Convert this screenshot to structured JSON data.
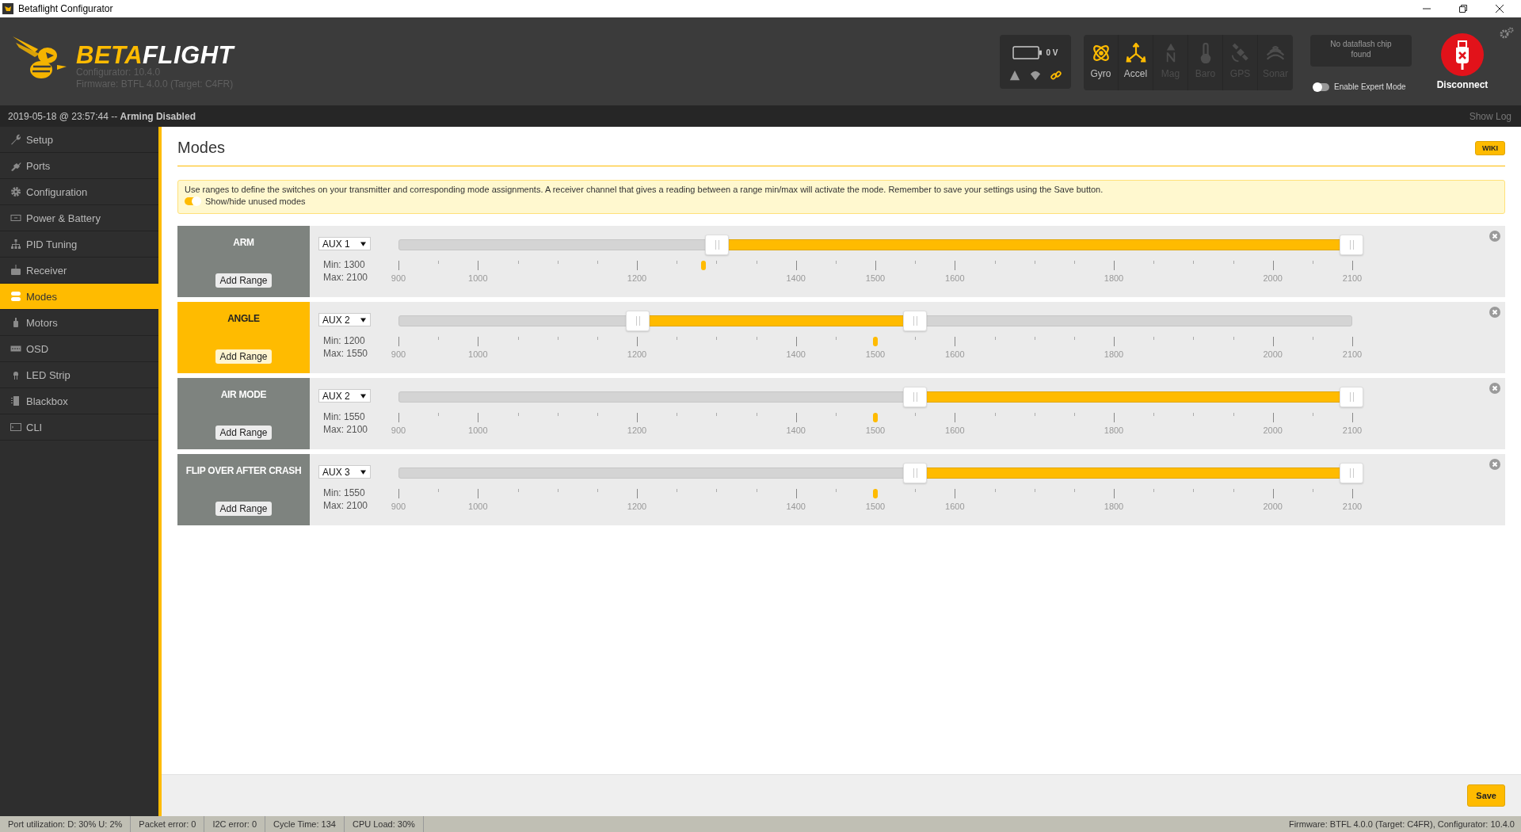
{
  "window": {
    "title": "Betaflight Configurator"
  },
  "header": {
    "logo": {
      "part_1": "BETA",
      "part_2": "FLIGHT"
    },
    "configurator_version": "Configurator: 10.4.0",
    "firmware": "Firmware: BTFL 4.0.0 (Target: C4FR)",
    "battery": {
      "voltage": "0 V"
    },
    "status_icons": [
      {
        "kind": "warning",
        "on": false
      },
      {
        "kind": "parachute",
        "on": false
      },
      {
        "kind": "link",
        "on": true
      }
    ],
    "sensors": [
      {
        "label": "Gyro",
        "kind": "gyro",
        "on": true
      },
      {
        "label": "Accel",
        "kind": "accel",
        "on": true
      },
      {
        "label": "Mag",
        "kind": "mag",
        "on": false
      },
      {
        "label": "Baro",
        "kind": "baro",
        "on": false
      },
      {
        "label": "GPS",
        "kind": "gps",
        "on": false
      },
      {
        "label": "Sonar",
        "kind": "sonar",
        "on": false
      }
    ],
    "dataflash": "No dataflash chip found",
    "expert_mode": {
      "label": "Enable Expert Mode",
      "on": false
    },
    "disconnect": "Disconnect"
  },
  "log_bar": {
    "message": "2019-05-18 @ 23:57:44 -- **Arming Disabled**",
    "show_log": "Show Log"
  },
  "sidebar": {
    "items": [
      {
        "label": "Setup",
        "kind": "wrench",
        "selected": false
      },
      {
        "label": "Ports",
        "kind": "plug",
        "selected": false
      },
      {
        "label": "Configuration",
        "kind": "gear",
        "selected": false
      },
      {
        "label": "Power & Battery",
        "kind": "battery",
        "selected": false
      },
      {
        "label": "PID Tuning",
        "kind": "tree",
        "selected": false
      },
      {
        "label": "Receiver",
        "kind": "receiver",
        "selected": false
      },
      {
        "label": "Modes",
        "kind": "toggles",
        "selected": true
      },
      {
        "label": "Motors",
        "kind": "motor",
        "selected": false
      },
      {
        "label": "OSD",
        "kind": "osd",
        "selected": false
      },
      {
        "label": "LED Strip",
        "kind": "led",
        "selected": false
      },
      {
        "label": "Blackbox",
        "kind": "blackbox",
        "selected": false
      },
      {
        "label": "CLI",
        "kind": "terminal",
        "selected": false
      }
    ]
  },
  "page": {
    "title": "Modes",
    "wiki": "WIKI",
    "note": "Use ranges to define the switches on your transmitter and corresponding mode assignments. A receiver channel that gives a reading between a range min/max will activate the mode. Remember to save your settings using the Save button.",
    "show_unused": {
      "label": "Show/hide unused modes",
      "on": true
    },
    "modes": [
      {
        "name": "ARM",
        "active": false,
        "add_range": "Add Range",
        "channel": "AUX 1",
        "min": "Min: 1300",
        "max": "Max: 2100",
        "low": {
          "level": 0.3333
        },
        "high": {
          "level": 1
        },
        "reading": {
          "level": 0.32
        },
        "scale": [
          "900",
          "1000",
          "1200",
          "1400",
          "1500",
          "1600",
          "1800",
          "2000",
          "2100"
        ]
      },
      {
        "name": "ANGLE",
        "active": true,
        "add_range": "Add Range",
        "channel": "AUX 2",
        "min": "Min: 1200",
        "max": "Max: 1550",
        "low": {
          "level": 0.25
        },
        "high": {
          "level": 0.5417
        },
        "reading": {
          "level": 0.5
        },
        "scale": [
          "900",
          "1000",
          "1200",
          "1400",
          "1500",
          "1600",
          "1800",
          "2000",
          "2100"
        ]
      },
      {
        "name": "AIR MODE",
        "active": false,
        "add_range": "Add Range",
        "channel": "AUX 2",
        "min": "Min: 1550",
        "max": "Max: 2100",
        "low": {
          "level": 0.5417
        },
        "high": {
          "level": 1
        },
        "reading": {
          "level": 0.5
        },
        "scale": [
          "900",
          "1000",
          "1200",
          "1400",
          "1500",
          "1600",
          "1800",
          "2000",
          "2100"
        ]
      },
      {
        "name": "FLIP OVER AFTER CRASH",
        "active": false,
        "add_range": "Add Range",
        "channel": "AUX 3",
        "min": "Min: 1550",
        "max": "Max: 2100",
        "low": {
          "level": 0.5417
        },
        "high": {
          "level": 1
        },
        "reading": {
          "level": 0.5
        },
        "scale": [
          "900",
          "1000",
          "1200",
          "1400",
          "1500",
          "1600",
          "1800",
          "2000",
          "2100"
        ]
      }
    ],
    "save": "Save"
  },
  "status_bar": {
    "items": [
      "Port utilization: D: 30% U: 2%",
      "Packet error: 0",
      "I2C error: 0",
      "Cycle Time: 134",
      "CPU Load: 30%"
    ],
    "version": "Firmware: BTFL 4.0.0 (Target: C4FR), Configurator: 10.4.0"
  }
}
